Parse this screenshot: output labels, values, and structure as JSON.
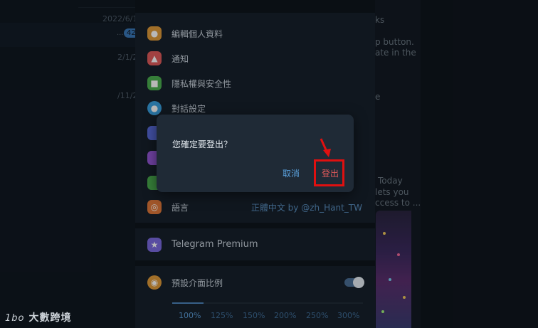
{
  "chat_list": {
    "rows": [
      {
        "date": "2022/6/1",
        "badge": "42",
        "dots": "..."
      },
      {
        "date": "2/1/2"
      },
      {
        "date": "/11/2"
      }
    ]
  },
  "right_panel": {
    "lines": [
      "ks",
      "p button.",
      "ate in the",
      "e",
      "Today",
      "lets you",
      "ccess to ..."
    ]
  },
  "settings": {
    "items": [
      {
        "label": "編輯個人資料",
        "icon": "person-icon",
        "color": "#e09a3a"
      },
      {
        "label": "通知",
        "icon": "bell-icon",
        "color": "#e05a5a"
      },
      {
        "label": "隱私權與安全性",
        "icon": "lock-icon",
        "color": "#4caf50"
      },
      {
        "label": "對話設定",
        "icon": "chat-bubble-icon",
        "color": "#3aa0e0"
      },
      {
        "label": "",
        "icon": "folder-icon",
        "color": "#5a6ee0"
      },
      {
        "label": "",
        "icon": "palette-icon",
        "color": "#9a5ae0"
      },
      {
        "label": "",
        "icon": "phone-icon",
        "color": "#4caf50"
      },
      {
        "label": "語言",
        "icon": "globe-icon",
        "color": "#e0783a",
        "value": "正體中文 by @zh_Hant_TW"
      }
    ],
    "premium": {
      "label": "Telegram Premium",
      "icon": "star-icon",
      "color": "#7a6ae0"
    },
    "interface_scale": {
      "label": "預設介面比例",
      "icon": "eye-icon",
      "color": "#e09a3a",
      "enabled": true,
      "options": [
        "100%",
        "125%",
        "150%",
        "200%",
        "250%",
        "300%"
      ],
      "selected": "100%"
    }
  },
  "dialog": {
    "question": "您確定要登出？",
    "cancel_label": "取消",
    "logout_label": "登出"
  },
  "watermark": {
    "logo": "1bo",
    "text": "大數跨境"
  }
}
